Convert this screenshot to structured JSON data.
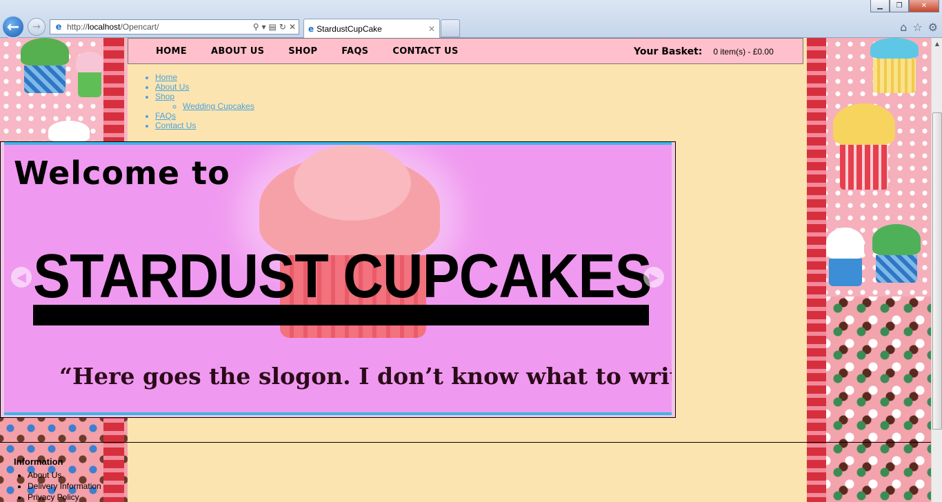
{
  "browser": {
    "address": "http://localhost/Opencart/",
    "address_host": "localhost",
    "tab_title": "StardustCupCake",
    "window_controls": [
      "minimize",
      "maximize",
      "close"
    ],
    "icons": [
      "back-icon",
      "forward-icon",
      "home-icon",
      "star-icon",
      "gear-icon"
    ]
  },
  "nav": {
    "items": [
      "HOME",
      "ABOUT US",
      "SHOP",
      "FAQS",
      "CONTACT US"
    ],
    "basket_label": "Your Basket:",
    "basket_value": "0 item(s) - £0.00"
  },
  "sitemap": {
    "items": [
      "Home",
      "About Us",
      "Shop",
      "FAQs",
      "Contact Us"
    ],
    "sub_items": [
      "Wedding Cupcakes"
    ]
  },
  "slider": {
    "welcome": "Welcome to",
    "brand": "STARDUST CUPCAKES",
    "slogan": "“Here goes the slogon. I don’t know what to write”"
  },
  "footer": {
    "heading": "Information",
    "links": [
      "About Us",
      "Delivery Information",
      "Privacy Policy"
    ]
  },
  "colors": {
    "nav_bg": "#ffc0cb",
    "content_bg": "#fce4b0",
    "link": "#4aa3df",
    "slide_bg": "#f099f0",
    "slide_border": "#3bb6e8"
  }
}
